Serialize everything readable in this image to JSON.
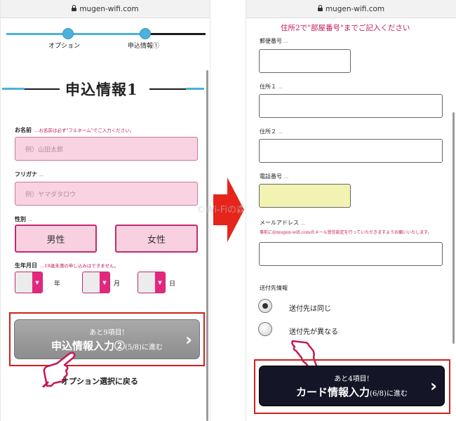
{
  "left": {
    "url": "mugen-wifi.com",
    "progress_steps": [
      "オプション",
      "申込情報①"
    ],
    "title": "申込情報1",
    "name_label": "お名前",
    "name_hint": "…お名前は必ず\"フルネーム\"でご入力ください。",
    "name_placeholder": "例）山田太郎",
    "kana_label": "フリガナ",
    "kana_required": "…",
    "kana_placeholder": "例）ヤマダタロウ",
    "gender_label": "性別",
    "gender_required": "…",
    "gender_male": "男性",
    "gender_female": "女性",
    "birth_label": "生年月日",
    "birth_hint": "…18歳未満の申し込みはできません。",
    "birth_units": [
      "年",
      "月",
      "日"
    ],
    "next_sub": "あと9項目!",
    "next_main": "申込情報入力②",
    "next_progress": "(5/8)",
    "next_suffix": "に進む",
    "back_link": "オプション選択に戻る"
  },
  "watermark": "©Wi-Fiの森",
  "right": {
    "url": "mugen-wifi.com",
    "top_note": "住所2で\"部屋番号\"までご記入ください",
    "postal_label": "郵便番号",
    "address1_label": "住所１",
    "address2_label": "住所２",
    "phone_label": "電話番号",
    "email_label": "メールアドレス",
    "email_note": "事前に@mugen-wifi.comのメール受信設定を行っていただきますようお願いいたします。",
    "required_mark": "…",
    "shipping_label": "送付先情報",
    "ship_same": "送付先は同じ",
    "ship_different": "送付先が異なる",
    "next_sub": "あと4項目!",
    "next_main": "カード情報入力",
    "next_progress": "(6/8)",
    "next_suffix": "に進む"
  },
  "icons": {
    "chevron": "chevron-right-icon",
    "select_arrow": "▼",
    "chevron_glyph": "›"
  },
  "colors": {
    "accent_pink": "#c2185b",
    "step_blue": "#4ab2dd",
    "arrow_red": "#e5251b",
    "field_pink": "#f9d3e2",
    "phone_yellow": "#f2f3b3",
    "dark_button": "#151528"
  }
}
